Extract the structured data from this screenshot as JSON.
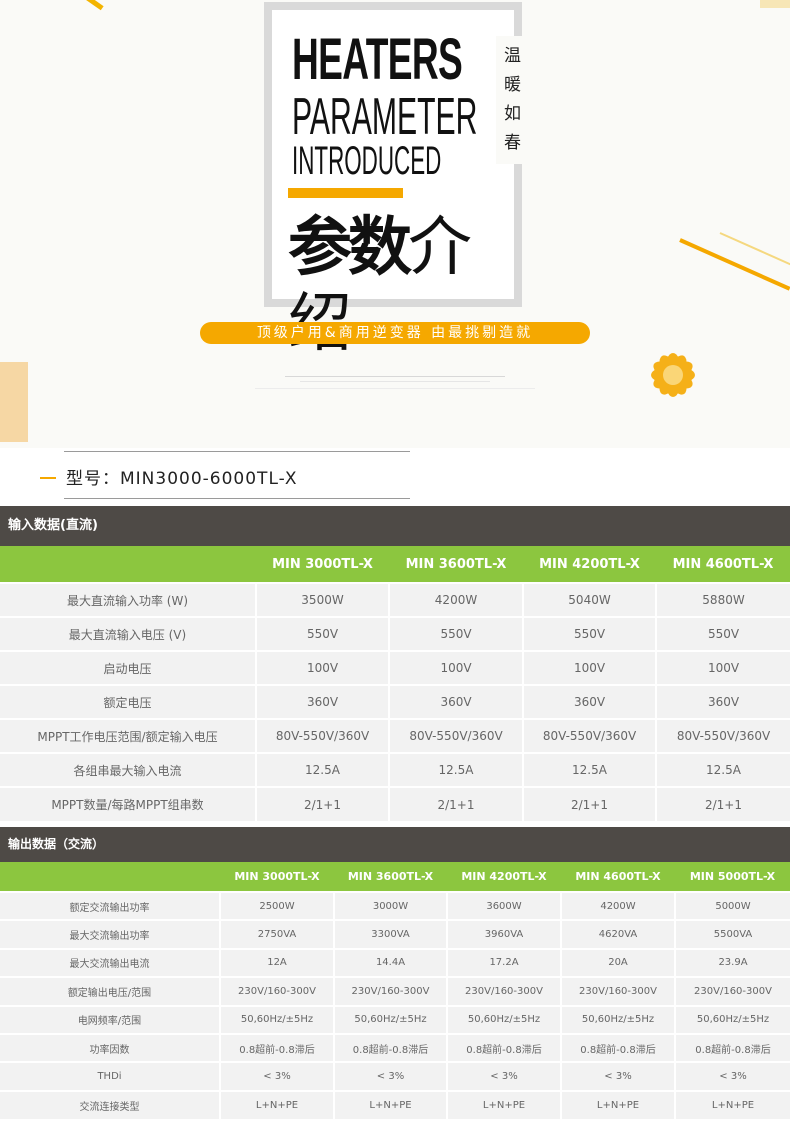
{
  "hero": {
    "title_line1": "HEATERS",
    "title_line2": "PARAMETER",
    "title_line3": "INTRODUCED",
    "cn_title_bold": "参数",
    "cn_title_thin": "介绍",
    "side_text": [
      "温",
      "暖",
      "如",
      "春"
    ],
    "slogan": "顶级户用&商用逆变器 由最挑剔造就",
    "accent_color": "#f5a800"
  },
  "model": {
    "label": "型号：MIN3000-6000TL-X"
  },
  "input_section": {
    "title": "输入数据(直流)",
    "columns": [
      "",
      "MIN 3000TL-X",
      "MIN 3600TL-X",
      "MIN 4200TL-X",
      "MIN 4600TL-X"
    ],
    "rows": [
      [
        "最大直流输入功率 (W)",
        "3500W",
        "4200W",
        "5040W",
        "5880W"
      ],
      [
        "最大直流输入电压 (V)",
        "550V",
        "550V",
        "550V",
        "550V"
      ],
      [
        "启动电压",
        "100V",
        "100V",
        "100V",
        "100V"
      ],
      [
        "额定电压",
        "360V",
        "360V",
        "360V",
        "360V"
      ],
      [
        "MPPT工作电压范围/额定输入电压",
        "80V-550V/360V",
        "80V-550V/360V",
        "80V-550V/360V",
        "80V-550V/360V"
      ],
      [
        "各组串最大输入电流",
        "12.5A",
        "12.5A",
        "12.5A",
        "12.5A"
      ],
      [
        "MPPT数量/每路MPPT组串数",
        "2/1+1",
        "2/1+1",
        "2/1+1",
        "2/1+1"
      ]
    ]
  },
  "output_section": {
    "title": "输出数据（交流）",
    "columns": [
      "",
      "MIN 3000TL-X",
      "MIN 3600TL-X",
      "MIN 4200TL-X",
      "MIN 4600TL-X",
      "MIN 5000TL-X"
    ],
    "rows": [
      [
        "额定交流输出功率",
        "2500W",
        "3000W",
        "3600W",
        "4200W",
        "5000W"
      ],
      [
        "最大交流输出功率",
        "2750VA",
        "3300VA",
        "3960VA",
        "4620VA",
        "5500VA"
      ],
      [
        "最大交流输出电流",
        "12A",
        "14.4A",
        "17.2A",
        "20A",
        "23.9A"
      ],
      [
        "额定输出电压/范围",
        "230V/160-300V",
        "230V/160-300V",
        "230V/160-300V",
        "230V/160-300V",
        "230V/160-300V"
      ],
      [
        "电网频率/范围",
        "50,60Hz/±5Hz",
        "50,60Hz/±5Hz",
        "50,60Hz/±5Hz",
        "50,60Hz/±5Hz",
        "50,60Hz/±5Hz"
      ],
      [
        "功率因数",
        "0.8超前-0.8滞后",
        "0.8超前-0.8滞后",
        "0.8超前-0.8滞后",
        "0.8超前-0.8滞后",
        "0.8超前-0.8滞后"
      ],
      [
        "THDi",
        "< 3%",
        "< 3%",
        "< 3%",
        "< 3%",
        "< 3%"
      ],
      [
        "交流连接类型",
        "L+N+PE",
        "L+N+PE",
        "L+N+PE",
        "L+N+PE",
        "L+N+PE"
      ]
    ]
  },
  "colors": {
    "header_bg": "#4e4a46",
    "column_header_bg": "#8cc63f",
    "cell_bg": "#f2f2f2"
  }
}
